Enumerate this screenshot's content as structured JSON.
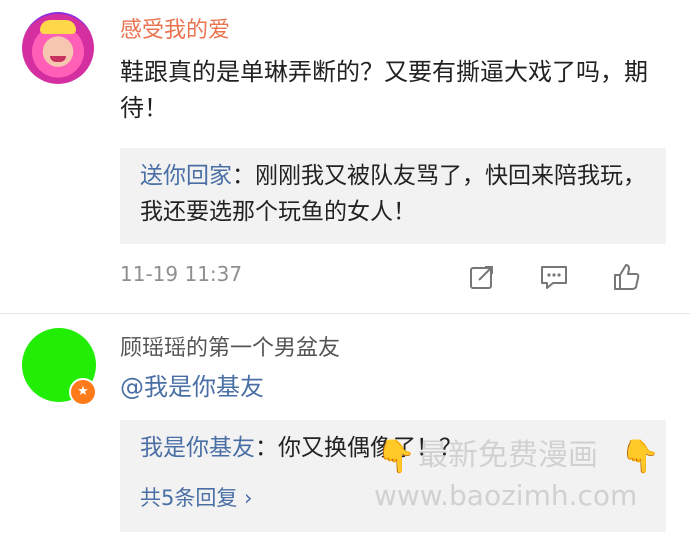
{
  "comment1": {
    "username": "感受我的爱",
    "body": "鞋跟真的是单琳弄断的？又要有撕逼大戏了吗，期待！",
    "reply": {
      "user": "送你回家",
      "separator": "：",
      "text": "刚刚我又被队友骂了，快回来陪我玩，我还要选那个玩鱼的女人！"
    },
    "timestamp": "11-19 11:37",
    "actions": {
      "share_icon": "share-icon",
      "comment_icon": "comment-icon",
      "like_icon": "like-icon"
    }
  },
  "comment2": {
    "username": "顾瑶瑶的第一个男盆友",
    "body": "@我是你基友",
    "reply": {
      "user": "我是你基友",
      "separator": "：",
      "text": "你又换偶像了！？"
    },
    "more": "共5条回复 ›"
  },
  "watermark": {
    "line1": "最新免费漫画",
    "line2": "www.baozimh.com"
  },
  "colors": {
    "username_orange": "#eb7350",
    "link_blue": "#4a6fa5",
    "avatar2_green": "#22ee05",
    "reply_bg": "#f2f2f2"
  }
}
